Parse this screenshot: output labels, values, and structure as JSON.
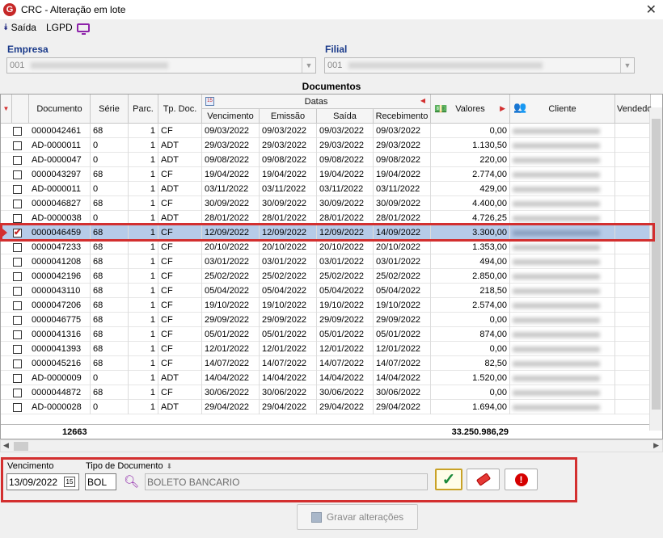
{
  "window": {
    "title": "CRC - Alteração em lote",
    "close": "✕"
  },
  "toolbar": {
    "exit_label": "Saída",
    "lgpd_label": "LGPD"
  },
  "empresa": {
    "label": "Empresa",
    "value": "001"
  },
  "filial": {
    "label": "Filial",
    "value": "001"
  },
  "section_title": "Documentos",
  "grid": {
    "group_header": "Datas",
    "columns": [
      "Documento",
      "Série",
      "Parc.",
      "Tp. Doc.",
      "Vencimento",
      "Emissão",
      "Saída",
      "Recebimento",
      "Valores",
      "Cliente",
      "Vendedo"
    ],
    "rows": [
      {
        "doc": "0000042461",
        "serie": "68",
        "parc": "1",
        "tp": "CF",
        "venc": "09/03/2022",
        "emis": "09/03/2022",
        "saida": "09/03/2022",
        "receb": "09/03/2022",
        "valor": "0,00",
        "checked": false
      },
      {
        "doc": "AD-0000011",
        "serie": "0",
        "parc": "1",
        "tp": "ADT",
        "venc": "29/03/2022",
        "emis": "29/03/2022",
        "saida": "29/03/2022",
        "receb": "29/03/2022",
        "valor": "1.130,50",
        "checked": false
      },
      {
        "doc": "AD-0000047",
        "serie": "0",
        "parc": "1",
        "tp": "ADT",
        "venc": "09/08/2022",
        "emis": "09/08/2022",
        "saida": "09/08/2022",
        "receb": "09/08/2022",
        "valor": "220,00",
        "checked": false
      },
      {
        "doc": "0000043297",
        "serie": "68",
        "parc": "1",
        "tp": "CF",
        "venc": "19/04/2022",
        "emis": "19/04/2022",
        "saida": "19/04/2022",
        "receb": "19/04/2022",
        "valor": "2.774,00",
        "checked": false
      },
      {
        "doc": "AD-0000011",
        "serie": "0",
        "parc": "1",
        "tp": "ADT",
        "venc": "03/11/2022",
        "emis": "03/11/2022",
        "saida": "03/11/2022",
        "receb": "03/11/2022",
        "valor": "429,00",
        "checked": false
      },
      {
        "doc": "0000046827",
        "serie": "68",
        "parc": "1",
        "tp": "CF",
        "venc": "30/09/2022",
        "emis": "30/09/2022",
        "saida": "30/09/2022",
        "receb": "30/09/2022",
        "valor": "4.400,00",
        "checked": false
      },
      {
        "doc": "AD-0000038",
        "serie": "0",
        "parc": "1",
        "tp": "ADT",
        "venc": "28/01/2022",
        "emis": "28/01/2022",
        "saida": "28/01/2022",
        "receb": "28/01/2022",
        "valor": "4.726,25",
        "checked": false
      },
      {
        "doc": "0000046459",
        "serie": "68",
        "parc": "1",
        "tp": "CF",
        "venc": "12/09/2022",
        "emis": "12/09/2022",
        "saida": "12/09/2022",
        "receb": "14/09/2022",
        "valor": "3.300,00",
        "checked": true,
        "selected": true
      },
      {
        "doc": "0000047233",
        "serie": "68",
        "parc": "1",
        "tp": "CF",
        "venc": "20/10/2022",
        "emis": "20/10/2022",
        "saida": "20/10/2022",
        "receb": "20/10/2022",
        "valor": "1.353,00",
        "checked": false
      },
      {
        "doc": "0000041208",
        "serie": "68",
        "parc": "1",
        "tp": "CF",
        "venc": "03/01/2022",
        "emis": "03/01/2022",
        "saida": "03/01/2022",
        "receb": "03/01/2022",
        "valor": "494,00",
        "checked": false
      },
      {
        "doc": "0000042196",
        "serie": "68",
        "parc": "1",
        "tp": "CF",
        "venc": "25/02/2022",
        "emis": "25/02/2022",
        "saida": "25/02/2022",
        "receb": "25/02/2022",
        "valor": "2.850,00",
        "checked": false
      },
      {
        "doc": "0000043110",
        "serie": "68",
        "parc": "1",
        "tp": "CF",
        "venc": "05/04/2022",
        "emis": "05/04/2022",
        "saida": "05/04/2022",
        "receb": "05/04/2022",
        "valor": "218,50",
        "checked": false
      },
      {
        "doc": "0000047206",
        "serie": "68",
        "parc": "1",
        "tp": "CF",
        "venc": "19/10/2022",
        "emis": "19/10/2022",
        "saida": "19/10/2022",
        "receb": "19/10/2022",
        "valor": "2.574,00",
        "checked": false
      },
      {
        "doc": "0000046775",
        "serie": "68",
        "parc": "1",
        "tp": "CF",
        "venc": "29/09/2022",
        "emis": "29/09/2022",
        "saida": "29/09/2022",
        "receb": "29/09/2022",
        "valor": "0,00",
        "checked": false
      },
      {
        "doc": "0000041316",
        "serie": "68",
        "parc": "1",
        "tp": "CF",
        "venc": "05/01/2022",
        "emis": "05/01/2022",
        "saida": "05/01/2022",
        "receb": "05/01/2022",
        "valor": "874,00",
        "checked": false
      },
      {
        "doc": "0000041393",
        "serie": "68",
        "parc": "1",
        "tp": "CF",
        "venc": "12/01/2022",
        "emis": "12/01/2022",
        "saida": "12/01/2022",
        "receb": "12/01/2022",
        "valor": "0,00",
        "checked": false
      },
      {
        "doc": "0000045216",
        "serie": "68",
        "parc": "1",
        "tp": "CF",
        "venc": "14/07/2022",
        "emis": "14/07/2022",
        "saida": "14/07/2022",
        "receb": "14/07/2022",
        "valor": "82,50",
        "checked": false
      },
      {
        "doc": "AD-0000009",
        "serie": "0",
        "parc": "1",
        "tp": "ADT",
        "venc": "14/04/2022",
        "emis": "14/04/2022",
        "saida": "14/04/2022",
        "receb": "14/04/2022",
        "valor": "1.520,00",
        "checked": false
      },
      {
        "doc": "0000044872",
        "serie": "68",
        "parc": "1",
        "tp": "CF",
        "venc": "30/06/2022",
        "emis": "30/06/2022",
        "saida": "30/06/2022",
        "receb": "30/06/2022",
        "valor": "0,00",
        "checked": false
      },
      {
        "doc": "AD-0000028",
        "serie": "0",
        "parc": "1",
        "tp": "ADT",
        "venc": "29/04/2022",
        "emis": "29/04/2022",
        "saida": "29/04/2022",
        "receb": "29/04/2022",
        "valor": "1.694,00",
        "checked": false
      }
    ],
    "footer": {
      "count": "12663",
      "total": "33.250.986,29"
    }
  },
  "form": {
    "vencimento_label": "Vencimento",
    "vencimento_value": "13/09/2022",
    "tipo_label": "Tipo de Documento",
    "tipo_code": "BOL",
    "tipo_desc": "BOLETO BANCARIO"
  },
  "save_button_label": "Gravar alterações",
  "colors": {
    "highlight": "#d32f2f",
    "selected_row": "#b6cbe8",
    "label_blue": "#1a3a8a"
  }
}
